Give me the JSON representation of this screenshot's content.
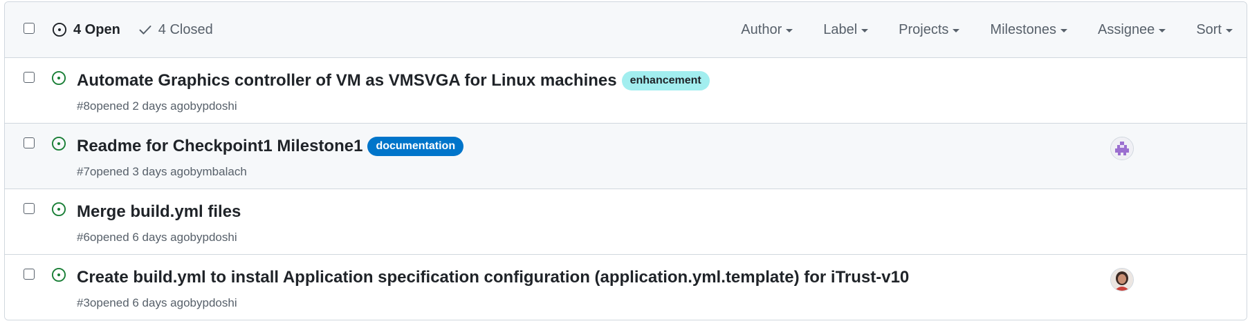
{
  "header": {
    "open_label": "4 Open",
    "closed_label": "4 Closed",
    "filters": [
      "Author",
      "Label",
      "Projects",
      "Milestones",
      "Assignee",
      "Sort"
    ]
  },
  "colors": {
    "open_icon": "#1a7f37",
    "enhancement_bg": "#a2eeef",
    "enhancement_fg": "#1f2328",
    "documentation_bg": "#0075ca",
    "documentation_fg": "#ffffff",
    "meta_text": "#57606a"
  },
  "issues": [
    {
      "title": "Automate Graphics controller of VM as VMSVGA for Linux machines",
      "label": "enhancement",
      "number": "#8",
      "opened": "opened 2 days ago",
      "by": "by",
      "author": "pdoshi",
      "icon": "issue-opened-icon"
    },
    {
      "title": "Readme for Checkpoint1 Milestone1",
      "label": "documentation",
      "number": "#7",
      "opened": "opened 3 days ago",
      "by": "by",
      "author": "mbalach",
      "icon": "issue-opened-icon",
      "assignee_avatar": "identicon-avatar"
    },
    {
      "title": "Merge build.yml files",
      "number": "#6",
      "opened": "opened 6 days ago",
      "by": "by",
      "author": "pdoshi",
      "icon": "issue-opened-icon"
    },
    {
      "title": "Create build.yml to install Application specification configuration (application.yml.template) for iTrust-v10",
      "number": "#3",
      "opened": "opened 6 days ago",
      "by": "by",
      "author": "pdoshi",
      "icon": "issue-opened-icon",
      "assignee_avatar": "user-photo-avatar"
    }
  ]
}
